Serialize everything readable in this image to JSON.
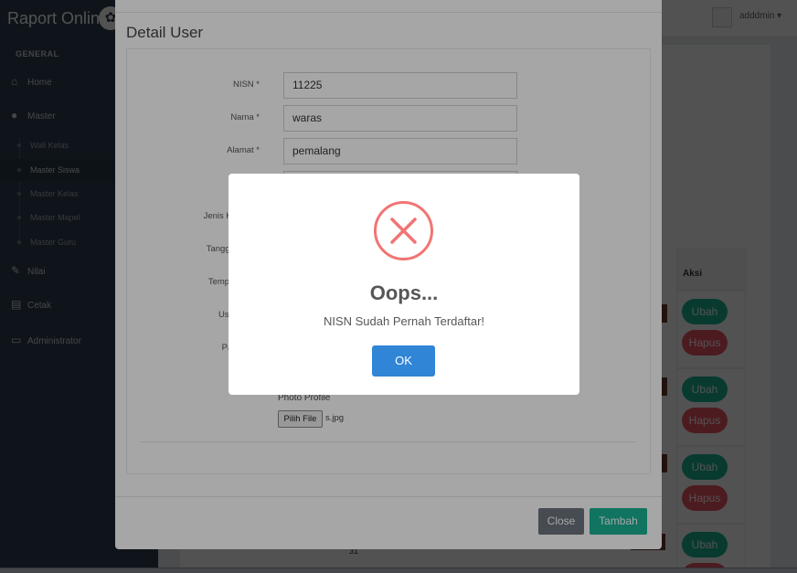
{
  "app": {
    "brand": "Raport Online",
    "user": "adddmin"
  },
  "sidebar": {
    "heading": "GENERAL",
    "items": [
      {
        "label": "Home",
        "icon": "home-icon"
      },
      {
        "label": "Master",
        "icon": "user-icon"
      },
      {
        "label": "Nilai",
        "icon": "edit-icon"
      },
      {
        "label": "Cetak",
        "icon": "print-icon"
      },
      {
        "label": "Administrator",
        "icon": "desktop-icon"
      }
    ],
    "sub_items": [
      {
        "label": "Wali Kelas",
        "active": false
      },
      {
        "label": "Master Siswa",
        "active": true
      },
      {
        "label": "Master Kelas",
        "active": false
      },
      {
        "label": "Master Mapel",
        "active": false
      },
      {
        "label": "Master Guru",
        "active": false
      }
    ]
  },
  "table": {
    "column_aksi": "Aksi",
    "edit_label": "Ubah",
    "delete_label": "Hapus",
    "bottom_value": "31"
  },
  "detail_modal": {
    "title": "Detail User",
    "fields": [
      {
        "label": "NISN *",
        "value": "11225"
      },
      {
        "label": "Nama *",
        "value": "waras"
      },
      {
        "label": "Alamat *",
        "value": "pemalang"
      }
    ],
    "hidden_labels": [
      "Jenis Ke",
      "Tanggal",
      "Tempat",
      "User",
      "Pas"
    ],
    "photo_label": "Photo Profile",
    "file_button": "Pilih File",
    "file_name": "s.jpg",
    "close_label": "Close",
    "submit_label": "Tambah"
  },
  "alert": {
    "icon": "error-x-icon",
    "title": "Oops...",
    "message": "NISN Sudah Pernah Terdaftar!",
    "ok_label": "OK"
  },
  "colors": {
    "sidebar": "#2f4050",
    "primary_green": "#1ab394",
    "danger_red": "#ed5565",
    "alert_button": "#3085d6",
    "error_icon": "#f27474"
  }
}
